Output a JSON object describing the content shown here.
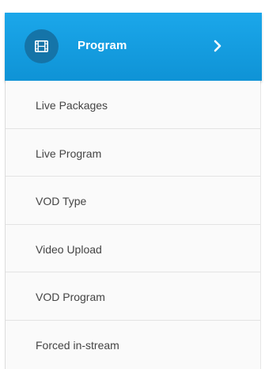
{
  "menu": {
    "header": {
      "label": "Program",
      "icon": "film-icon",
      "chevron_icon": "chevron-right-icon",
      "color": "#1ba7ea",
      "icon_bg_color": "#1574a8"
    },
    "items": [
      {
        "label": "Live Packages"
      },
      {
        "label": "Live Program"
      },
      {
        "label": "VOD Type"
      },
      {
        "label": "Video Upload"
      },
      {
        "label": "VOD Program"
      },
      {
        "label": "Forced in-stream"
      }
    ]
  }
}
